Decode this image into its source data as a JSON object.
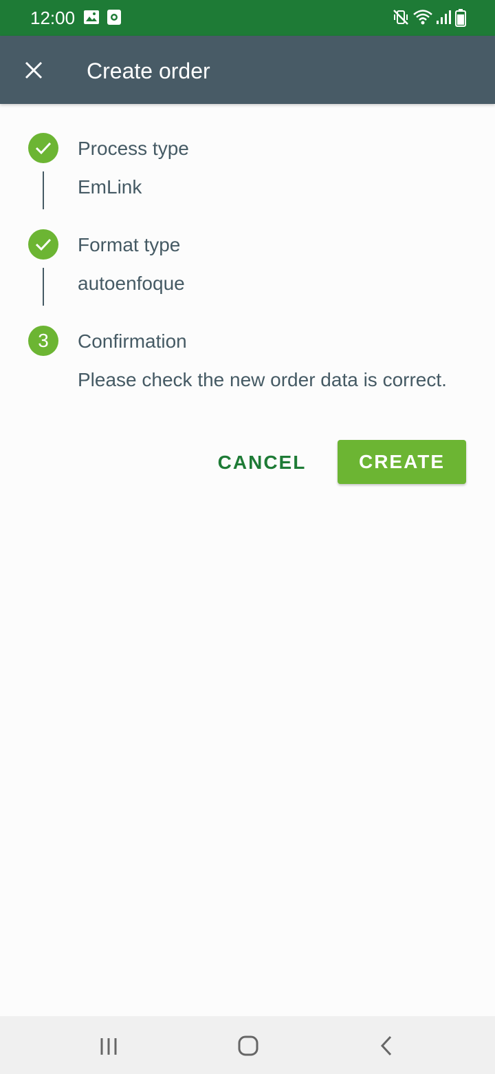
{
  "status_bar": {
    "time": "12:00",
    "icons": [
      "image-icon",
      "screen-record-icon",
      "vibrate-icon",
      "wifi-icon",
      "signal-icon",
      "battery-icon"
    ]
  },
  "app_bar": {
    "title": "Create order",
    "close_icon": "close-icon"
  },
  "stepper": {
    "steps": [
      {
        "title": "Process type",
        "value": "EmLink",
        "state": "completed"
      },
      {
        "title": "Format type",
        "value": "autoenfoque",
        "state": "completed"
      },
      {
        "number": "3",
        "title": "Confirmation",
        "description": "Please check the new order data is correct.",
        "state": "active"
      }
    ]
  },
  "actions": {
    "cancel_label": "CANCEL",
    "create_label": "CREATE"
  },
  "nav_bar": {
    "icons": [
      "recent-apps-icon",
      "home-icon",
      "back-icon"
    ]
  },
  "colors": {
    "status_bar": "#1e7b36",
    "app_bar": "#485b66",
    "accent": "#6cb533",
    "text": "#455a64"
  }
}
